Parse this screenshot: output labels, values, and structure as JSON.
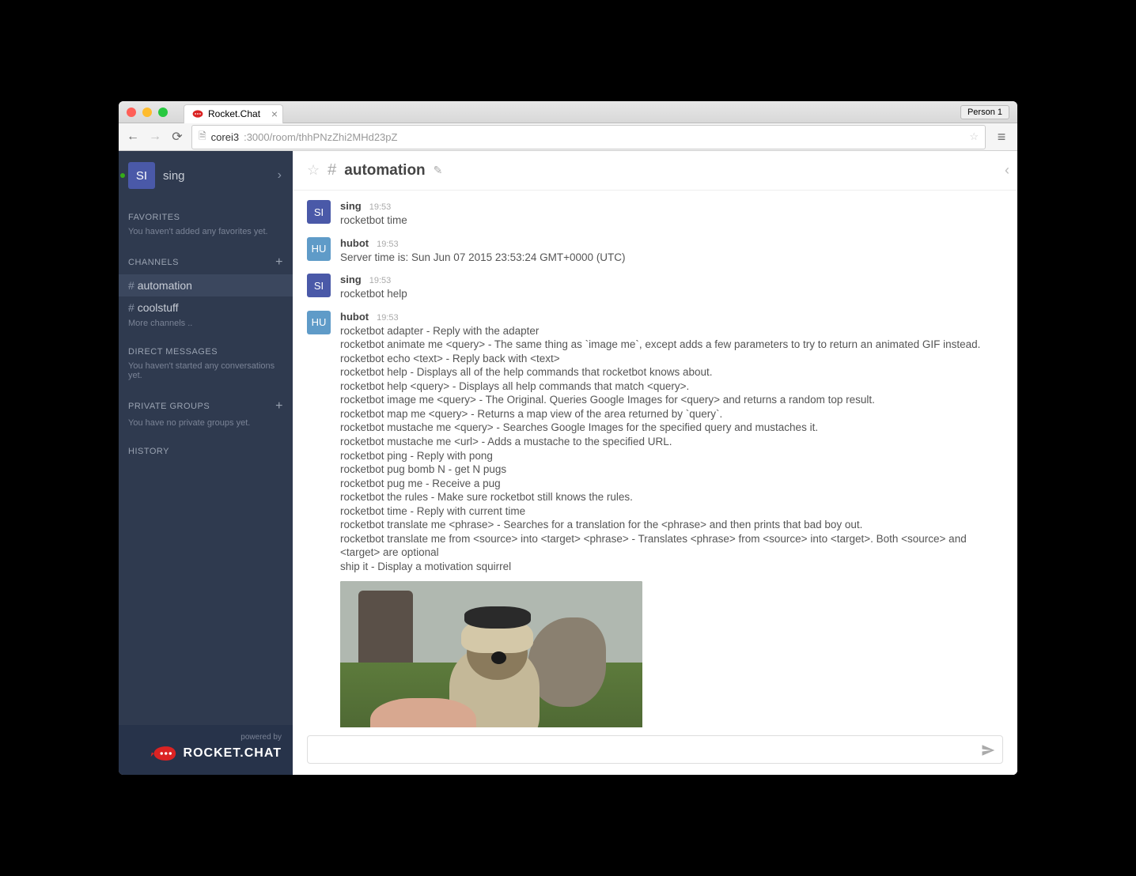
{
  "browser": {
    "tab_title": "Rocket.Chat",
    "person_badge": "Person 1",
    "url_host": "corei3",
    "url_path": ":3000/room/thhPNzZhi2MHd23pZ"
  },
  "sidebar": {
    "user": {
      "initials": "SI",
      "name": "sing"
    },
    "favorites": {
      "head": "FAVORITES",
      "sub": "You haven't added any favorites yet."
    },
    "channels": {
      "head": "CHANNELS",
      "items": [
        {
          "name": "automation",
          "active": true
        },
        {
          "name": "coolstuff",
          "active": false
        }
      ],
      "more": "More channels .."
    },
    "dms": {
      "head": "DIRECT MESSAGES",
      "sub": "You haven't started any conversations yet."
    },
    "groups": {
      "head": "PRIVATE GROUPS",
      "sub": "You have no private groups yet."
    },
    "history": {
      "head": "HISTORY"
    },
    "footer": {
      "powered": "powered by",
      "brand": "ROCKET.CHAT"
    }
  },
  "header": {
    "hash": "#",
    "title": "automation"
  },
  "messages": [
    {
      "avatar": "SI",
      "avclass": "si",
      "user": "sing",
      "time": "19:53",
      "lines": [
        "rocketbot time"
      ]
    },
    {
      "avatar": "HU",
      "avclass": "hu",
      "user": "hubot",
      "time": "19:53",
      "lines": [
        "Server time is: Sun Jun 07 2015 23:53:24 GMT+0000 (UTC)"
      ]
    },
    {
      "avatar": "SI",
      "avclass": "si",
      "user": "sing",
      "time": "19:53",
      "lines": [
        "rocketbot help"
      ]
    },
    {
      "avatar": "HU",
      "avclass": "hu",
      "user": "hubot",
      "time": "19:53",
      "lines": [
        "rocketbot adapter - Reply with the adapter",
        "rocketbot animate me <query> - The same thing as `image me`, except adds a few parameters to try to return an animated GIF instead.",
        "rocketbot echo <text> - Reply back with <text>",
        "rocketbot help - Displays all of the help commands that rocketbot knows about.",
        "rocketbot help <query> - Displays all help commands that match <query>.",
        "rocketbot image me <query> - The Original. Queries Google Images for <query> and returns a random top result.",
        "rocketbot map me <query> - Returns a map view of the area returned by `query`.",
        "rocketbot mustache me <query> - Searches Google Images for the specified query and mustaches it.",
        "rocketbot mustache me <url> - Adds a mustache to the specified URL.",
        "rocketbot ping - Reply with pong",
        "rocketbot pug bomb N - get N pugs",
        "rocketbot pug me - Receive a pug",
        "rocketbot the rules - Make sure rocketbot still knows the rules.",
        "rocketbot time - Reply with current time",
        "rocketbot translate me <phrase> - Searches for a translation for the <phrase> and then prints that bad boy out.",
        "rocketbot translate me from <source> into <target> <phrase> - Translates <phrase> from <source> into <target>. Both <source> and <target> are optional",
        "ship it - Display a motivation squirrel"
      ],
      "has_image": true
    }
  ],
  "compose": {
    "placeholder": ""
  }
}
